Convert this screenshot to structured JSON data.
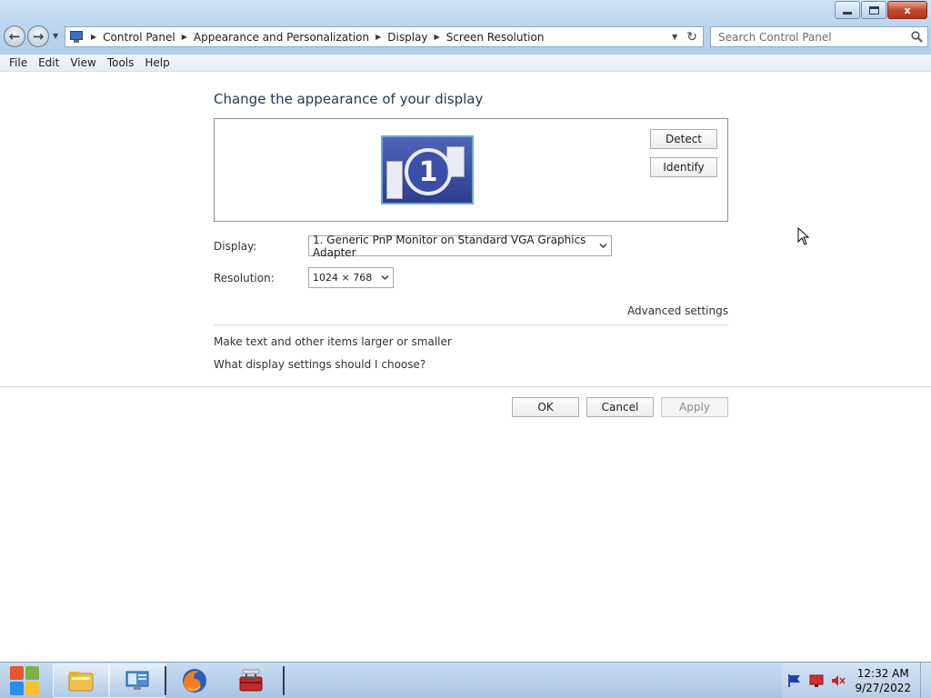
{
  "window": {
    "minimize_label": "",
    "maximize_label": "",
    "close_label": "x"
  },
  "address": {
    "breadcrumbs": [
      "Control Panel",
      "Appearance and Personalization",
      "Display",
      "Screen Resolution"
    ]
  },
  "search": {
    "placeholder": "Search Control Panel"
  },
  "menu": [
    "File",
    "Edit",
    "View",
    "Tools",
    "Help"
  ],
  "page": {
    "heading": "Change the appearance of your display",
    "monitor_number": "1",
    "detect_label": "Detect",
    "identify_label": "Identify",
    "display_label": "Display:",
    "display_value": "1. Generic PnP Monitor on Standard VGA Graphics Adapter",
    "resolution_label": "Resolution:",
    "resolution_value": "1024 × 768",
    "advanced_link": "Advanced settings",
    "link_text_size": "Make text and other items larger or smaller",
    "link_help": "What display settings should I choose?",
    "ok_label": "OK",
    "cancel_label": "Cancel",
    "apply_label": "Apply"
  },
  "taskbar": {
    "time": "12:32 AM",
    "date": "9/27/2022",
    "items": [
      "file-explorer-icon",
      "remote-desktop-icon",
      "firefox-icon",
      "toolbox-icon"
    ]
  },
  "colors": {
    "accent": "#1e3955",
    "close_red": "#c74a2f",
    "monitor_blue": "#2d3e8f"
  }
}
